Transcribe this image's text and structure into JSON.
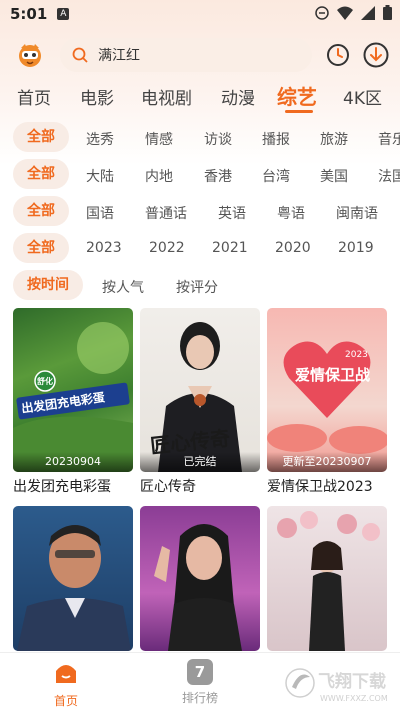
{
  "status": {
    "time": "5:01",
    "notif_letter": "A"
  },
  "search": {
    "query": "满江红"
  },
  "categories": [
    {
      "label": "首页",
      "active": false
    },
    {
      "label": "电影",
      "active": false
    },
    {
      "label": "电视剧",
      "active": false
    },
    {
      "label": "动漫",
      "active": false
    },
    {
      "label": "综艺",
      "active": true
    },
    {
      "label": "4K区",
      "active": false
    }
  ],
  "filters": {
    "type": [
      "全部",
      "选秀",
      "情感",
      "访谈",
      "播报",
      "旅游",
      "音乐"
    ],
    "region": [
      "全部",
      "大陆",
      "内地",
      "香港",
      "台湾",
      "美国",
      "法国"
    ],
    "language": [
      "全部",
      "国语",
      "普通话",
      "英语",
      "粤语",
      "闽南语"
    ],
    "year": [
      "全部",
      "2023",
      "2022",
      "2021",
      "2020",
      "2019"
    ],
    "sort": [
      "按时间",
      "按人气",
      "按评分"
    ]
  },
  "shows": [
    {
      "title": "出发团充电彩蛋",
      "badge": "20230904",
      "poster_text": "出发团充电彩蛋",
      "corner_text": "舒化"
    },
    {
      "title": "匠心传奇",
      "badge": "已完结",
      "poster_text": "匠心传奇"
    },
    {
      "title": "爱情保卫战2023",
      "badge": "更新至20230907",
      "poster_text": "爱情保卫战",
      "corner_text": "2023"
    },
    {
      "title": "",
      "badge": ""
    },
    {
      "title": "",
      "badge": ""
    },
    {
      "title": "",
      "badge": ""
    }
  ],
  "bottom_nav": [
    {
      "label": "首页",
      "active": true,
      "icon_text": ""
    },
    {
      "label": "排行榜",
      "active": false,
      "icon_text": "7"
    }
  ],
  "watermark": {
    "text": "飞翔下载",
    "url": "WWW.FXXZ.COM"
  },
  "colors": {
    "accent": "#f06a1f",
    "chip_bg": "#f8ece5",
    "search_bg": "#faeee6"
  }
}
